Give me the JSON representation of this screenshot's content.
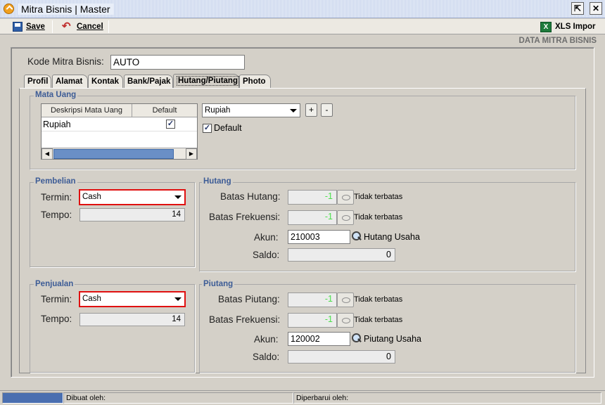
{
  "window": {
    "title": "Mitra Bisnis | Master",
    "restore_symbol": "⇱",
    "close_symbol": "✕"
  },
  "toolbar": {
    "save_label": "Save",
    "cancel_label": "Cancel",
    "import_label": "XLS Impor",
    "xls_icon_text": "X"
  },
  "section_title": "DATA MITRA BISNIS",
  "kode": {
    "label": "Kode Mitra Bisnis:",
    "value": "AUTO"
  },
  "tabs": [
    {
      "label": "Profil"
    },
    {
      "label": "Alamat"
    },
    {
      "label": "Kontak"
    },
    {
      "label": "Bank/Pajak"
    },
    {
      "label": "Hutang/Piutang",
      "active": true
    },
    {
      "label": "Photo"
    }
  ],
  "mata_uang": {
    "legend": "Mata Uang",
    "columns": [
      "Deskripsi Mata Uang",
      "Default"
    ],
    "rows": [
      {
        "deskripsi": "Rupiah",
        "default": true
      }
    ],
    "select_value": "Rupiah",
    "add_label": "+",
    "remove_label": "-",
    "default_label": "Default",
    "check_mark": "✓"
  },
  "pembelian": {
    "legend": "Pembelian",
    "termin_label": "Termin:",
    "termin_value": "Cash",
    "tempo_label": "Tempo:",
    "tempo_value": "14"
  },
  "penjualan": {
    "legend": "Penjualan",
    "termin_label": "Termin:",
    "termin_value": "Cash",
    "tempo_label": "Tempo:",
    "tempo_value": "14"
  },
  "hutang": {
    "legend": "Hutang",
    "batas_label": "Batas Hutang:",
    "batas_value": "-1",
    "batas_note": "Tidak terbatas",
    "frekuensi_label": "Batas Frekuensi:",
    "frekuensi_value": "-1",
    "frekuensi_note": "Tidak terbatas",
    "akun_label": "Akun:",
    "akun_value": "210003",
    "akun_name": "Hutang Usaha",
    "saldo_label": "Saldo:",
    "saldo_value": "0"
  },
  "piutang": {
    "legend": "Piutang",
    "batas_label": "Batas Piutang:",
    "batas_value": "-1",
    "batas_note": "Tidak terbatas",
    "frekuensi_label": "Batas Frekuensi:",
    "frekuensi_value": "-1",
    "frekuensi_note": "Tidak terbatas",
    "akun_label": "Akun:",
    "akun_value": "120002",
    "akun_name": "Piutang Usaha",
    "saldo_label": "Saldo:",
    "saldo_value": "0"
  },
  "status": {
    "dibuat_label": "Dibuat oleh:",
    "diperbarui_label": "Diperbarui oleh:"
  },
  "colors": {
    "legend": "#3d5c96",
    "highlight": "#e01010",
    "limit_value": "#4ce04c"
  }
}
